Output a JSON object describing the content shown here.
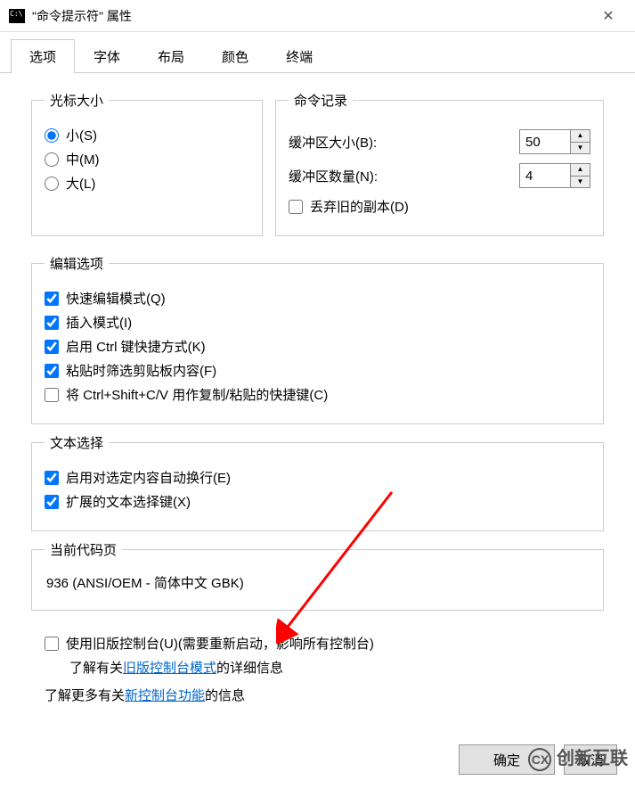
{
  "window": {
    "title": "\"命令提示符\" 属性"
  },
  "tabs": {
    "options": "选项",
    "font": "字体",
    "layout": "布局",
    "color": "颜色",
    "terminal": "终端"
  },
  "cursor": {
    "legend": "光标大小",
    "small": "小(S)",
    "medium": "中(M)",
    "large": "大(L)"
  },
  "history": {
    "legend": "命令记录",
    "buffer_size_label": "缓冲区大小(B):",
    "buffer_size_value": "50",
    "buffer_count_label": "缓冲区数量(N):",
    "buffer_count_value": "4",
    "discard_old": "丢弃旧的副本(D)"
  },
  "edit": {
    "legend": "编辑选项",
    "quick_edit": "快速编辑模式(Q)",
    "insert_mode": "插入模式(I)",
    "ctrl_shortcut": "启用 Ctrl 键快捷方式(K)",
    "filter_clipboard": "粘贴时筛选剪贴板内容(F)",
    "ctrl_shift_cv": "将 Ctrl+Shift+C/V 用作复制/粘贴的快捷键(C)"
  },
  "text_select": {
    "legend": "文本选择",
    "line_wrap": "启用对选定内容自动换行(E)",
    "extended_keys": "扩展的文本选择键(X)"
  },
  "codepage": {
    "legend": "当前代码页",
    "value": "936   (ANSI/OEM - 简体中文 GBK)"
  },
  "footer": {
    "legacy_check": "使用旧版控制台(U)(需要重新启动，影响所有控制台)",
    "legacy_link_prefix": "了解有关",
    "legacy_link": "旧版控制台模式",
    "legacy_link_suffix": "的详细信息",
    "new_link_prefix": "了解更多有关",
    "new_link": "新控制台功能",
    "new_link_suffix": "的信息"
  },
  "buttons": {
    "ok": "确定",
    "cancel": "取消"
  },
  "watermark": "创新互联"
}
